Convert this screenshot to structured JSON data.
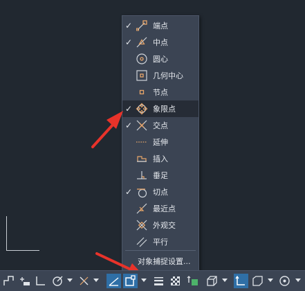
{
  "menu": {
    "items": [
      {
        "label": "端点",
        "checked": true,
        "icon": "endpoint-snap-icon",
        "highlighted": false
      },
      {
        "label": "中点",
        "checked": true,
        "icon": "midpoint-snap-icon",
        "highlighted": false
      },
      {
        "label": "圆心",
        "checked": false,
        "icon": "center-snap-icon",
        "highlighted": false
      },
      {
        "label": "几何中心",
        "checked": false,
        "icon": "geometric-center-snap-icon",
        "highlighted": false
      },
      {
        "label": "节点",
        "checked": false,
        "icon": "node-snap-icon",
        "highlighted": false
      },
      {
        "label": "象限点",
        "checked": true,
        "icon": "quadrant-snap-icon",
        "highlighted": true
      },
      {
        "label": "交点",
        "checked": true,
        "icon": "intersection-snap-icon",
        "highlighted": false
      },
      {
        "label": "延伸",
        "checked": false,
        "icon": "extension-snap-icon",
        "highlighted": false
      },
      {
        "label": "插入",
        "checked": false,
        "icon": "insert-snap-icon",
        "highlighted": false
      },
      {
        "label": "垂足",
        "checked": false,
        "icon": "perpendicular-snap-icon",
        "highlighted": false
      },
      {
        "label": "切点",
        "checked": true,
        "icon": "tangent-snap-icon",
        "highlighted": false
      },
      {
        "label": "最近点",
        "checked": false,
        "icon": "nearest-snap-icon",
        "highlighted": false
      },
      {
        "label": "外观交",
        "checked": false,
        "icon": "apparent-intersection-snap-icon",
        "highlighted": false
      },
      {
        "label": "平行",
        "checked": false,
        "icon": "parallel-snap-icon",
        "highlighted": false
      }
    ],
    "settings_label": "对象捕捉设置..."
  },
  "colors": {
    "accent": "#2f6fa6",
    "snap_icon": "#e8a66a",
    "arrow": "#e8332a",
    "menu_bg": "#3b4453",
    "canvas_bg": "#212830"
  }
}
